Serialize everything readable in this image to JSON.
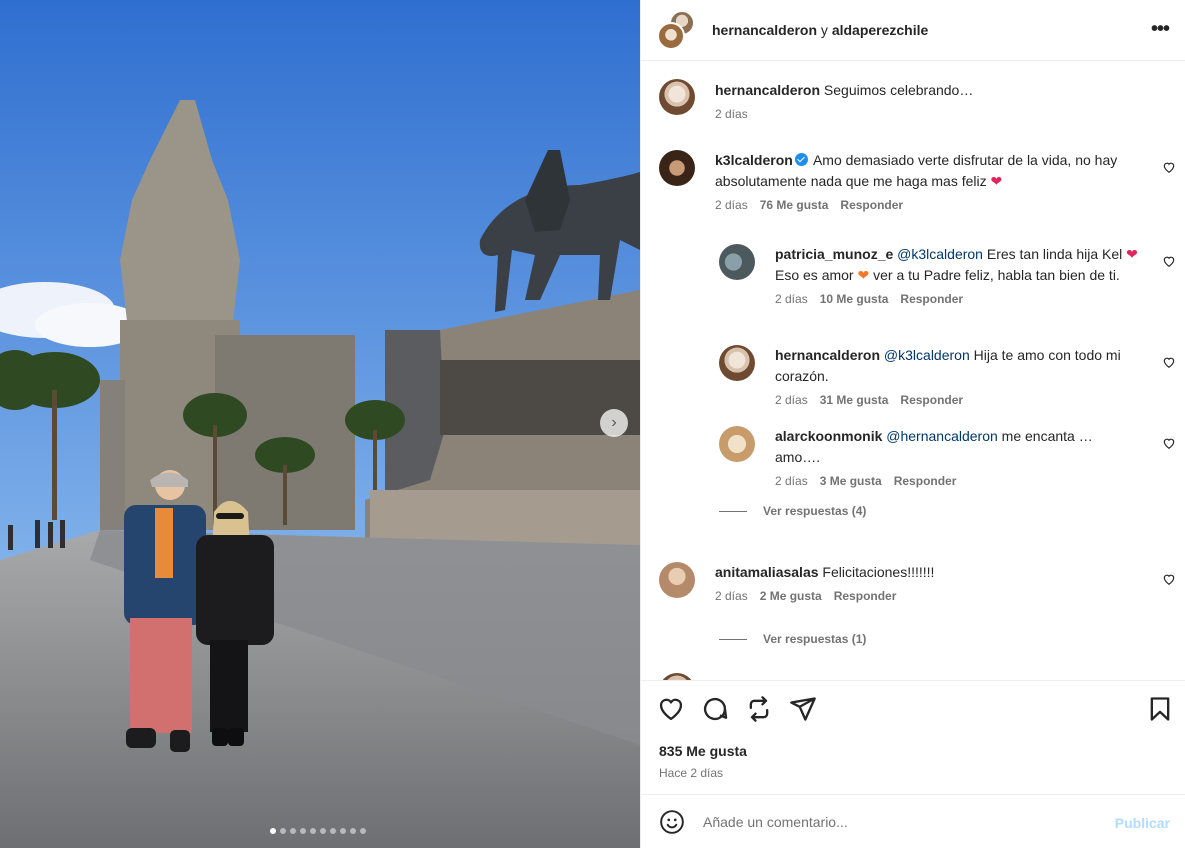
{
  "header": {
    "user1": "hernancalderon",
    "connector": "y",
    "user2": "aldaperezchile"
  },
  "caption": {
    "username": "hernancalderon",
    "text": "Seguimos celebrando…",
    "time": "2 días"
  },
  "comments": [
    {
      "username": "k3lcalderon",
      "verified": true,
      "text": "Amo demasiado verte disfrutar de la vida, no hay absolutamente nada que me haga mas feliz",
      "emoji": "❤",
      "time": "2 días",
      "likes": "76 Me gusta",
      "reply": "Responder"
    },
    {
      "username": "patricia_munoz_e",
      "mention": "@k3lcalderon",
      "text_a": "Eres tan linda hija Kel",
      "emoji_a": "❤",
      "text_b": "Eso es amor",
      "emoji_b": "❤",
      "text_c": "ver a tu Padre feliz, habla tan bien de ti.",
      "time": "2 días",
      "likes": "10 Me gusta",
      "reply": "Responder"
    },
    {
      "username": "hernancalderon",
      "mention": "@k3lcalderon",
      "text": "Hija te amo con todo mi corazón.",
      "time": "2 días",
      "likes": "31 Me gusta",
      "reply": "Responder"
    },
    {
      "username": "alarckoonmonik",
      "mention": "@hernancalderon",
      "text": "me encanta …amo….",
      "time": "2 días",
      "likes": "3 Me gusta",
      "reply": "Responder"
    },
    {
      "username": "anitamaliasalas",
      "text": "Felicitaciones!!!!!!!",
      "time": "2 días",
      "likes": "2 Me gusta",
      "reply": "Responder"
    }
  ],
  "view_replies": [
    "Ver respuestas (4)",
    "Ver respuestas (1)"
  ],
  "actions": {
    "likes": "835 Me gusta",
    "ago": "Hace 2 días"
  },
  "composer": {
    "placeholder": "Añade un comentario...",
    "publish": "Publicar"
  },
  "icons": {
    "more": "more-options-icon",
    "like": "heart-icon",
    "comment": "comment-icon",
    "repost": "repost-icon",
    "share": "share-icon",
    "save": "bookmark-icon",
    "emoji": "emoji-icon",
    "next": "chevron-right-icon"
  },
  "colors": {
    "link": "#00376b",
    "publish_disabled": "#b3dbff",
    "muted": "#737373",
    "verified": "#1f8ef1"
  }
}
